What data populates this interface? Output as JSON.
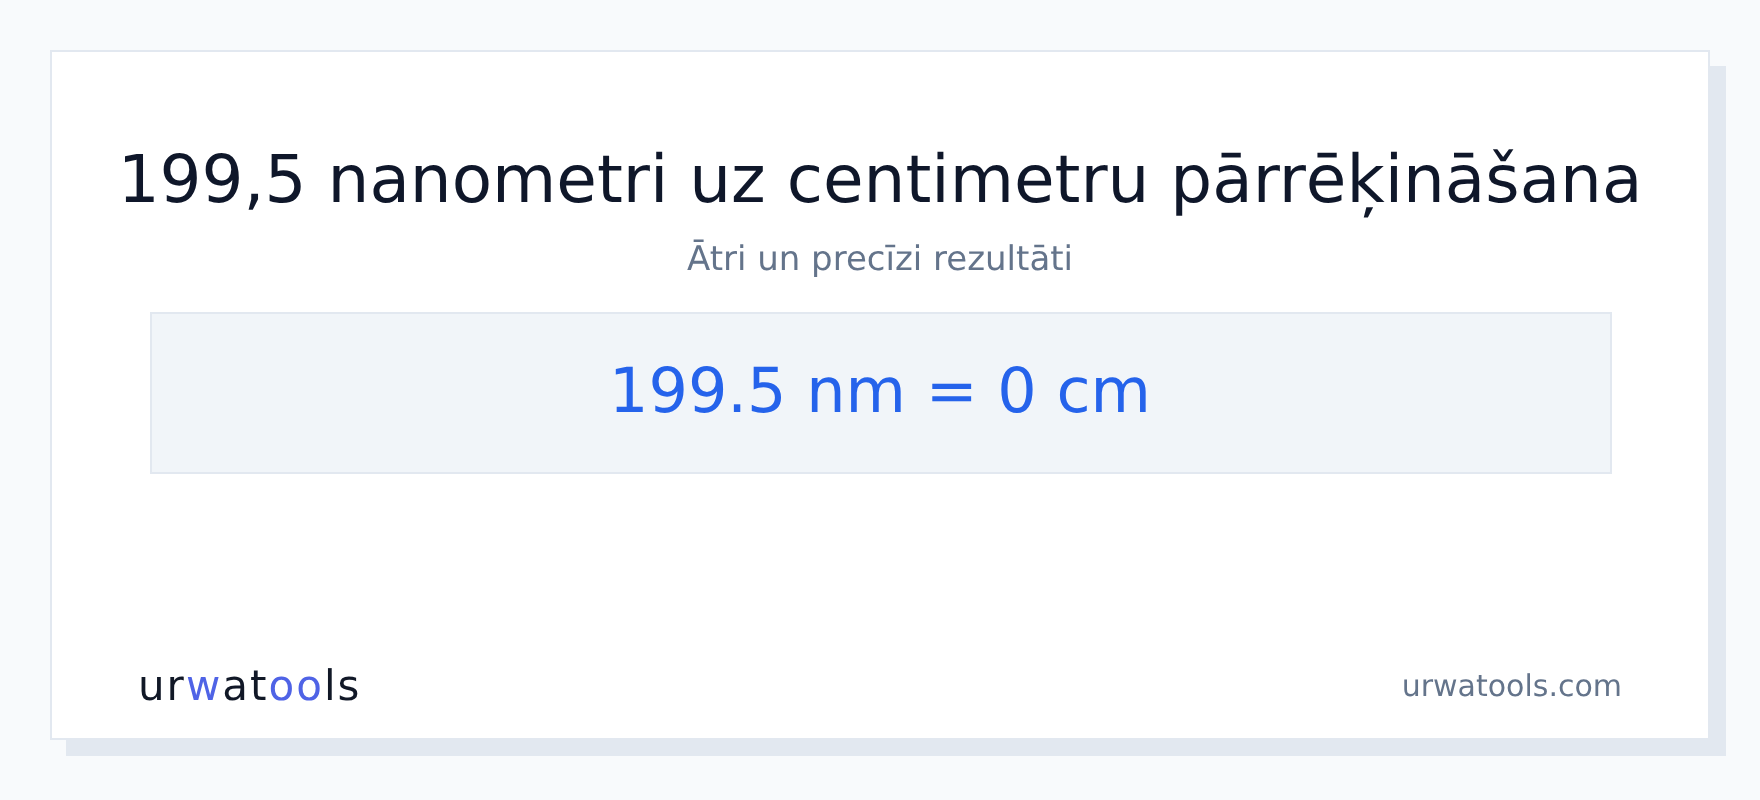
{
  "title": "199,5 nanometri uz centimetru pārrēķināšana",
  "subtitle": "Ātri un precīzi rezultāti",
  "result": "199.5 nm = 0 cm",
  "logo": {
    "segments": [
      {
        "text": "ur",
        "accent": false
      },
      {
        "text": "w",
        "accent": true
      },
      {
        "text": "at",
        "accent": false
      },
      {
        "text": "oo",
        "accent": true
      },
      {
        "text": "ls",
        "accent": false
      }
    ]
  },
  "site": "urwatools.com"
}
